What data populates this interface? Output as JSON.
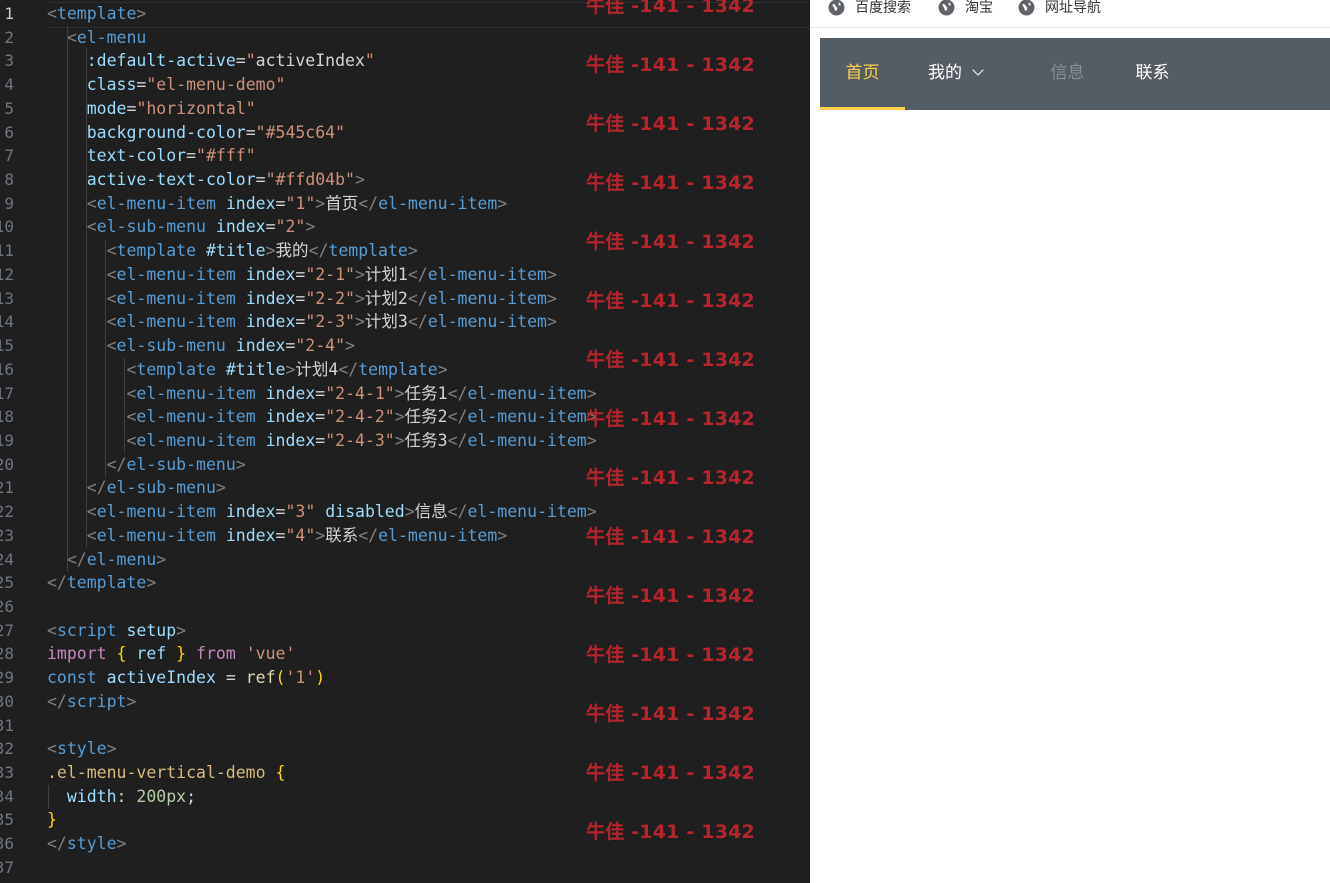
{
  "editor": {
    "active_line": 1,
    "line_numbers": [
      "1",
      "2",
      "3",
      "4",
      "5",
      "6",
      "7",
      "8",
      "9",
      "10",
      "11",
      "12",
      "13",
      "14",
      "15",
      "16",
      "17",
      "18",
      "19",
      "20",
      "21",
      "22",
      "23",
      "24",
      "25",
      "26",
      "27",
      "28",
      "29",
      "30",
      "31",
      "32",
      "33",
      "34",
      "35",
      "36",
      "37"
    ],
    "lines": [
      [
        [
          "t-br",
          "<"
        ],
        [
          "t-tag",
          "template"
        ],
        [
          "t-br",
          ">"
        ]
      ],
      [
        [
          "t-txt",
          "  "
        ],
        [
          "t-br",
          "<"
        ],
        [
          "t-tag",
          "el-menu"
        ]
      ],
      [
        [
          "t-txt",
          "    "
        ],
        [
          "t-attr",
          ":default-active"
        ],
        [
          "t-eq",
          "="
        ],
        [
          "t-str",
          "\""
        ],
        [
          "t-txt",
          "activeIndex"
        ],
        [
          "t-str",
          "\""
        ]
      ],
      [
        [
          "t-txt",
          "    "
        ],
        [
          "t-attr",
          "class"
        ],
        [
          "t-eq",
          "="
        ],
        [
          "t-str",
          "\"el-menu-demo\""
        ]
      ],
      [
        [
          "t-txt",
          "    "
        ],
        [
          "t-attr",
          "mode"
        ],
        [
          "t-eq",
          "="
        ],
        [
          "t-str",
          "\"horizontal\""
        ]
      ],
      [
        [
          "t-txt",
          "    "
        ],
        [
          "t-attr",
          "background-color"
        ],
        [
          "t-eq",
          "="
        ],
        [
          "t-str",
          "\"#545c64\""
        ]
      ],
      [
        [
          "t-txt",
          "    "
        ],
        [
          "t-attr",
          "text-color"
        ],
        [
          "t-eq",
          "="
        ],
        [
          "t-str",
          "\"#fff\""
        ]
      ],
      [
        [
          "t-txt",
          "    "
        ],
        [
          "t-attr",
          "active-text-color"
        ],
        [
          "t-eq",
          "="
        ],
        [
          "t-str",
          "\"#ffd04b\""
        ],
        [
          "t-br",
          ">"
        ]
      ],
      [
        [
          "t-txt",
          "    "
        ],
        [
          "t-br",
          "<"
        ],
        [
          "t-tag",
          "el-menu-item"
        ],
        [
          "t-txt",
          " "
        ],
        [
          "t-attr",
          "index"
        ],
        [
          "t-eq",
          "="
        ],
        [
          "t-str",
          "\"1\""
        ],
        [
          "t-br",
          ">"
        ],
        [
          "t-txt",
          "首页"
        ],
        [
          "t-br",
          "</"
        ],
        [
          "t-tag",
          "el-menu-item"
        ],
        [
          "t-br",
          ">"
        ]
      ],
      [
        [
          "t-txt",
          "    "
        ],
        [
          "t-br",
          "<"
        ],
        [
          "t-tag",
          "el-sub-menu"
        ],
        [
          "t-txt",
          " "
        ],
        [
          "t-attr",
          "index"
        ],
        [
          "t-eq",
          "="
        ],
        [
          "t-str",
          "\"2\""
        ],
        [
          "t-br",
          ">"
        ]
      ],
      [
        [
          "t-txt",
          "      "
        ],
        [
          "t-br",
          "<"
        ],
        [
          "t-tag",
          "template"
        ],
        [
          "t-txt",
          " "
        ],
        [
          "t-attr",
          "#title"
        ],
        [
          "t-br",
          ">"
        ],
        [
          "t-txt",
          "我的"
        ],
        [
          "t-br",
          "</"
        ],
        [
          "t-tag",
          "template"
        ],
        [
          "t-br",
          ">"
        ]
      ],
      [
        [
          "t-txt",
          "      "
        ],
        [
          "t-br",
          "<"
        ],
        [
          "t-tag",
          "el-menu-item"
        ],
        [
          "t-txt",
          " "
        ],
        [
          "t-attr",
          "index"
        ],
        [
          "t-eq",
          "="
        ],
        [
          "t-str",
          "\"2-1\""
        ],
        [
          "t-br",
          ">"
        ],
        [
          "t-txt",
          "计划1"
        ],
        [
          "t-br",
          "</"
        ],
        [
          "t-tag",
          "el-menu-item"
        ],
        [
          "t-br",
          ">"
        ]
      ],
      [
        [
          "t-txt",
          "      "
        ],
        [
          "t-br",
          "<"
        ],
        [
          "t-tag",
          "el-menu-item"
        ],
        [
          "t-txt",
          " "
        ],
        [
          "t-attr",
          "index"
        ],
        [
          "t-eq",
          "="
        ],
        [
          "t-str",
          "\"2-2\""
        ],
        [
          "t-br",
          ">"
        ],
        [
          "t-txt",
          "计划2"
        ],
        [
          "t-br",
          "</"
        ],
        [
          "t-tag",
          "el-menu-item"
        ],
        [
          "t-br",
          ">"
        ]
      ],
      [
        [
          "t-txt",
          "      "
        ],
        [
          "t-br",
          "<"
        ],
        [
          "t-tag",
          "el-menu-item"
        ],
        [
          "t-txt",
          " "
        ],
        [
          "t-attr",
          "index"
        ],
        [
          "t-eq",
          "="
        ],
        [
          "t-str",
          "\"2-3\""
        ],
        [
          "t-br",
          ">"
        ],
        [
          "t-txt",
          "计划3"
        ],
        [
          "t-br",
          "</"
        ],
        [
          "t-tag",
          "el-menu-item"
        ],
        [
          "t-br",
          ">"
        ]
      ],
      [
        [
          "t-txt",
          "      "
        ],
        [
          "t-br",
          "<"
        ],
        [
          "t-tag",
          "el-sub-menu"
        ],
        [
          "t-txt",
          " "
        ],
        [
          "t-attr",
          "index"
        ],
        [
          "t-eq",
          "="
        ],
        [
          "t-str",
          "\"2-4\""
        ],
        [
          "t-br",
          ">"
        ]
      ],
      [
        [
          "t-txt",
          "        "
        ],
        [
          "t-br",
          "<"
        ],
        [
          "t-tag",
          "template"
        ],
        [
          "t-txt",
          " "
        ],
        [
          "t-attr",
          "#title"
        ],
        [
          "t-br",
          ">"
        ],
        [
          "t-txt",
          "计划4"
        ],
        [
          "t-br",
          "</"
        ],
        [
          "t-tag",
          "template"
        ],
        [
          "t-br",
          ">"
        ]
      ],
      [
        [
          "t-txt",
          "        "
        ],
        [
          "t-br",
          "<"
        ],
        [
          "t-tag",
          "el-menu-item"
        ],
        [
          "t-txt",
          " "
        ],
        [
          "t-attr",
          "index"
        ],
        [
          "t-eq",
          "="
        ],
        [
          "t-str",
          "\"2-4-1\""
        ],
        [
          "t-br",
          ">"
        ],
        [
          "t-txt",
          "任务1"
        ],
        [
          "t-br",
          "</"
        ],
        [
          "t-tag",
          "el-menu-item"
        ],
        [
          "t-br",
          ">"
        ]
      ],
      [
        [
          "t-txt",
          "        "
        ],
        [
          "t-br",
          "<"
        ],
        [
          "t-tag",
          "el-menu-item"
        ],
        [
          "t-txt",
          " "
        ],
        [
          "t-attr",
          "index"
        ],
        [
          "t-eq",
          "="
        ],
        [
          "t-str",
          "\"2-4-2\""
        ],
        [
          "t-br",
          ">"
        ],
        [
          "t-txt",
          "任务2"
        ],
        [
          "t-br",
          "</"
        ],
        [
          "t-tag",
          "el-menu-item"
        ],
        [
          "t-br",
          ">"
        ]
      ],
      [
        [
          "t-txt",
          "        "
        ],
        [
          "t-br",
          "<"
        ],
        [
          "t-tag",
          "el-menu-item"
        ],
        [
          "t-txt",
          " "
        ],
        [
          "t-attr",
          "index"
        ],
        [
          "t-eq",
          "="
        ],
        [
          "t-str",
          "\"2-4-3\""
        ],
        [
          "t-br",
          ">"
        ],
        [
          "t-txt",
          "任务3"
        ],
        [
          "t-br",
          "</"
        ],
        [
          "t-tag",
          "el-menu-item"
        ],
        [
          "t-br",
          ">"
        ]
      ],
      [
        [
          "t-txt",
          "      "
        ],
        [
          "t-br",
          "</"
        ],
        [
          "t-tag",
          "el-sub-menu"
        ],
        [
          "t-br",
          ">"
        ]
      ],
      [
        [
          "t-txt",
          "    "
        ],
        [
          "t-br",
          "</"
        ],
        [
          "t-tag",
          "el-sub-menu"
        ],
        [
          "t-br",
          ">"
        ]
      ],
      [
        [
          "t-txt",
          "    "
        ],
        [
          "t-br",
          "<"
        ],
        [
          "t-tag",
          "el-menu-item"
        ],
        [
          "t-txt",
          " "
        ],
        [
          "t-attr",
          "index"
        ],
        [
          "t-eq",
          "="
        ],
        [
          "t-str",
          "\"3\""
        ],
        [
          "t-txt",
          " "
        ],
        [
          "t-attr",
          "disabled"
        ],
        [
          "t-br",
          ">"
        ],
        [
          "t-txt",
          "信息"
        ],
        [
          "t-br",
          "</"
        ],
        [
          "t-tag",
          "el-menu-item"
        ],
        [
          "t-br",
          ">"
        ]
      ],
      [
        [
          "t-txt",
          "    "
        ],
        [
          "t-br",
          "<"
        ],
        [
          "t-tag",
          "el-menu-item"
        ],
        [
          "t-txt",
          " "
        ],
        [
          "t-attr",
          "index"
        ],
        [
          "t-eq",
          "="
        ],
        [
          "t-str",
          "\"4\""
        ],
        [
          "t-br",
          ">"
        ],
        [
          "t-txt",
          "联系"
        ],
        [
          "t-br",
          "</"
        ],
        [
          "t-tag",
          "el-menu-item"
        ],
        [
          "t-br",
          ">"
        ]
      ],
      [
        [
          "t-txt",
          "  "
        ],
        [
          "t-br",
          "</"
        ],
        [
          "t-tag",
          "el-menu"
        ],
        [
          "t-br",
          ">"
        ]
      ],
      [
        [
          "t-br",
          "</"
        ],
        [
          "t-tag",
          "template"
        ],
        [
          "t-br",
          ">"
        ]
      ],
      [],
      [
        [
          "t-br",
          "<"
        ],
        [
          "t-tag",
          "script"
        ],
        [
          "t-txt",
          " "
        ],
        [
          "t-attr",
          "setup"
        ],
        [
          "t-br",
          ">"
        ]
      ],
      [
        [
          "t-kw",
          "import"
        ],
        [
          "t-txt",
          " "
        ],
        [
          "t-brace",
          "{"
        ],
        [
          "t-txt",
          " "
        ],
        [
          "t-var",
          "ref"
        ],
        [
          "t-txt",
          " "
        ],
        [
          "t-brace",
          "}"
        ],
        [
          "t-txt",
          " "
        ],
        [
          "t-kw",
          "from"
        ],
        [
          "t-txt",
          " "
        ],
        [
          "t-str",
          "'vue'"
        ]
      ],
      [
        [
          "t-kw2",
          "const"
        ],
        [
          "t-txt",
          " "
        ],
        [
          "t-var",
          "activeIndex"
        ],
        [
          "t-txt",
          " = "
        ],
        [
          "t-fn",
          "ref"
        ],
        [
          "t-brace",
          "("
        ],
        [
          "t-str",
          "'1'"
        ],
        [
          "t-brace",
          ")"
        ]
      ],
      [
        [
          "t-br",
          "</"
        ],
        [
          "t-tag",
          "script"
        ],
        [
          "t-br",
          ">"
        ]
      ],
      [],
      [
        [
          "t-br",
          "<"
        ],
        [
          "t-tag",
          "style"
        ],
        [
          "t-br",
          ">"
        ]
      ],
      [
        [
          "t-sel",
          ".el-menu-vertical-demo"
        ],
        [
          "t-txt",
          " "
        ],
        [
          "t-brace",
          "{"
        ]
      ],
      [
        [
          "t-txt",
          "  "
        ],
        [
          "t-attr",
          "width"
        ],
        [
          "t-txt",
          ": "
        ],
        [
          "t-num",
          "200px"
        ],
        [
          "t-txt",
          ";"
        ]
      ],
      [
        [
          "t-brace",
          "}"
        ]
      ],
      [
        [
          "t-br",
          "</"
        ],
        [
          "t-tag",
          "style"
        ],
        [
          "t-br",
          ">"
        ]
      ],
      []
    ],
    "watermark": "牛佳 -141 - 1342"
  },
  "bookmarks": [
    {
      "label": "百度搜索",
      "icon": "globe-icon"
    },
    {
      "label": "淘宝",
      "icon": "globe-icon"
    },
    {
      "label": "网址导航",
      "icon": "globe-icon"
    }
  ],
  "menu": {
    "background_color": "#545c64",
    "text_color": "#fff",
    "active_text_color": "#ffd04b",
    "items": [
      {
        "label": "首页",
        "state": "active"
      },
      {
        "label": "我的",
        "state": "submenu"
      },
      {
        "label": "信息",
        "state": "disabled"
      },
      {
        "label": "联系",
        "state": "normal"
      }
    ]
  }
}
